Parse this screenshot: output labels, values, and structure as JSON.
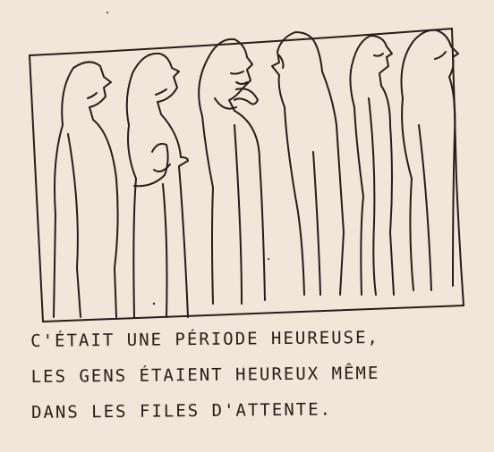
{
  "caption": {
    "line1": "C'ÉTAIT UNE PÉRIODE HEUREUSE,",
    "line2": "LES GENS ÉTAIENT HEUREUX MÊME",
    "line3": "DANS LES FILES D'ATTENTE."
  },
  "colors": {
    "paper": "#f1e6d8",
    "ink": "#2a1a1c"
  }
}
